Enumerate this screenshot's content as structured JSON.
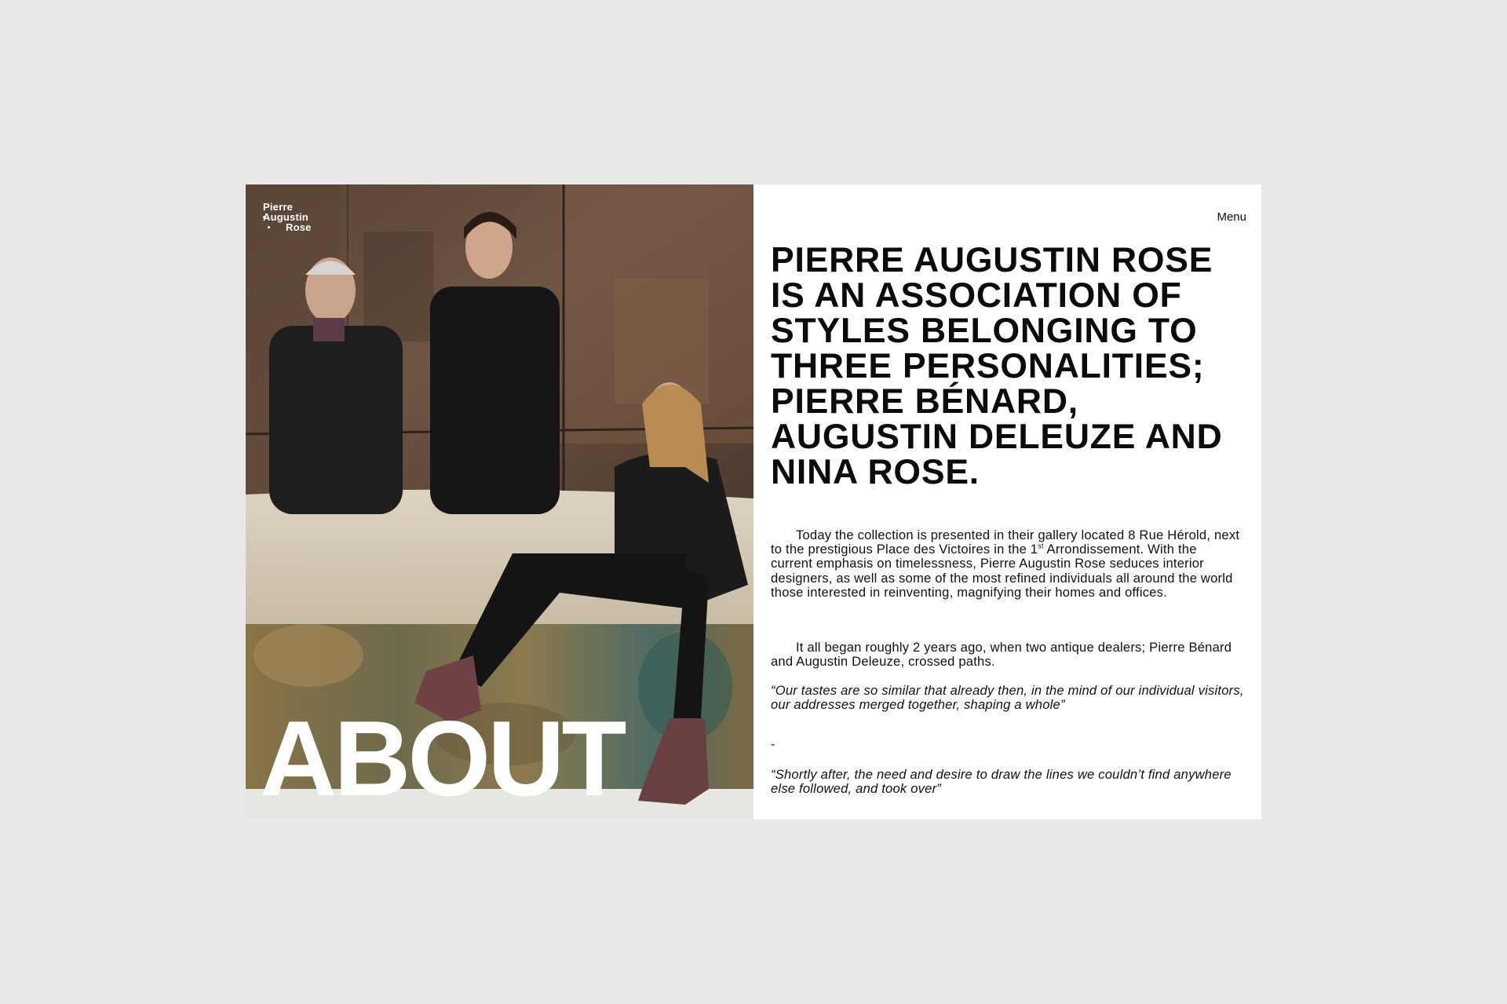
{
  "brand": {
    "logo_line1": "Pierre",
    "logo_line2": "Augustin",
    "logo_line3": "Rose"
  },
  "photo": {
    "overlay_title": "ABOUT"
  },
  "nav": {
    "menu_label": "Menu"
  },
  "content": {
    "headline": "PIERRE AUGUSTIN ROSE IS AN ASSOCIATION OF STYLES BELONGING TO THREE PERSONALITIES; PIERRE BÉNARD, AUGUSTIN DELEUZE AND NINA ROSE.",
    "paragraph1_a": "Today the collection is presented in their gallery located 8 Rue Hérold, next to the prestigious Place des Victoires in the 1",
    "paragraph1_sup": "st",
    "paragraph1_b": " Arrondissement. With the current emphasis on timelessness, Pierre Augustin Rose seduces interior designers, as well as some of the most refined individuals all around the world those interested in reinventing, magnifying their homes and offices.",
    "paragraph2": "It all began roughly 2 years ago, when two antique dealers; Pierre Bénard and Augustin Deleuze, crossed paths.",
    "quote1": "“Our tastes are so similar that already then, in the mind of our individual visitors, our addresses merged together, shaping a whole”",
    "separator": "-",
    "quote2": "“Shortly after, the need and desire to draw the lines we couldn’t find anywhere else followed, and took over”"
  },
  "colors": {
    "page_background": "#e9e9e9",
    "panel_background": "#ffffff",
    "text": "#0b0b0b"
  }
}
